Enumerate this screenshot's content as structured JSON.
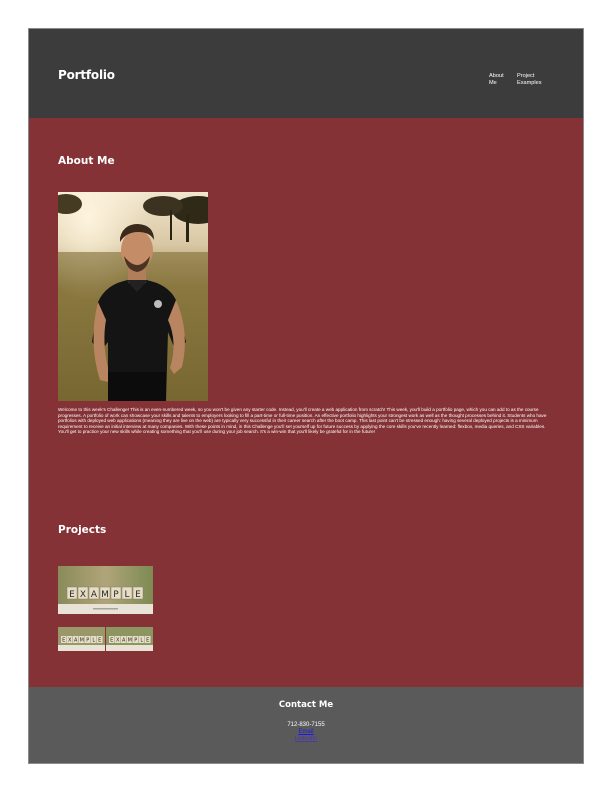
{
  "header": {
    "brand": "Portfolio",
    "nav": [
      {
        "label": "About Me"
      },
      {
        "label": "Project Examples"
      }
    ]
  },
  "about": {
    "title": "About Me",
    "text": "Welcome to this week's Challenge! This is an even-numbered week, so you won't be given any starter code. Instead, you'll create a web application from scratch! This week, you'll build a portfolio page, which you can add to as the course progresses. A portfolio of work can showcase your skills and talents to employers looking to fill a part-time or full-time position. An effective portfolio highlights your strongest work as well as the thought processes behind it. Students who have portfolios with deployed web applications (meaning they are live on the web) are typically very successful in their career search after the boot camp. This last point can't be stressed enough: having several deployed projects is a minimum requirement to receive an initial interview at many companies. With these points in mind, in this Challenge you'll set yourself up for future success by applying the core skills you've recently learned: flexbox, media queries, and CSS variables. You'll get to practice your new skills while creating something that you'll use during your job search. It's a win-win that you'll likely be grateful for in the future!"
  },
  "projects": {
    "title": "Projects",
    "items": [
      {
        "tile_text": "EXAMPLE"
      },
      {
        "tile_text": "EXAMPLE"
      }
    ]
  },
  "footer": {
    "title": "Contact Me",
    "phone": "712-830-7155",
    "email_label": "Email",
    "linkedin_label": "LinkedIn"
  },
  "colors": {
    "header_bg": "#3c3c3c",
    "main_bg": "#843236",
    "footer_bg": "#5a5a5a",
    "text": "#ffffff",
    "link": "#1a1aee"
  }
}
